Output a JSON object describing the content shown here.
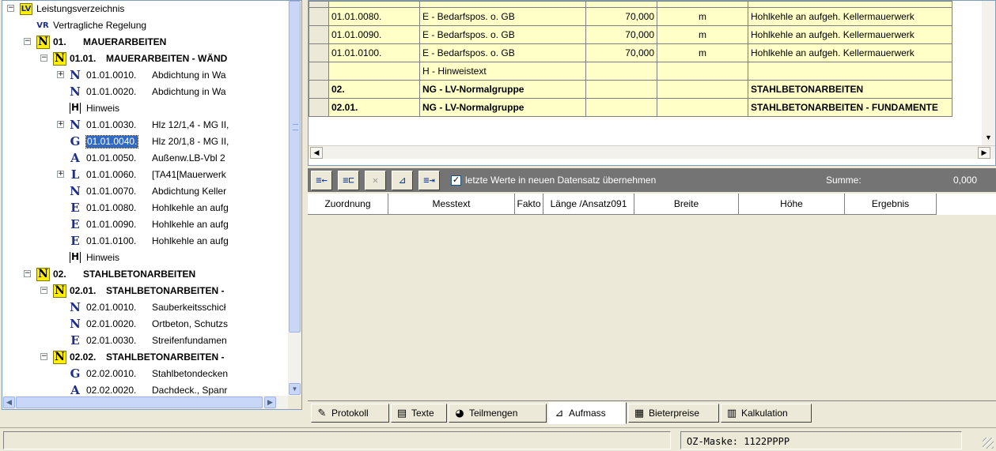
{
  "tree": {
    "nodes": [
      {
        "indent": 0,
        "expander": "−",
        "icon": "LV",
        "icon_label": "LV",
        "text": "Leistungsverzeichnis",
        "tail": "",
        "bold": false,
        "selected": false
      },
      {
        "indent": 1,
        "expander": "",
        "icon": "VR",
        "icon_label": "VR",
        "text": "Vertragliche Regelung",
        "tail": "",
        "bold": false,
        "selected": false
      },
      {
        "indent": 1,
        "expander": "−",
        "icon": "Nbox",
        "icon_label": "N",
        "text": "01.",
        "tail": "MAUERARBEITEN",
        "bold": true,
        "selected": false
      },
      {
        "indent": 2,
        "expander": "−",
        "icon": "Nbox",
        "icon_label": "N",
        "text": "01.01.",
        "tail": "MAUERARBEITEN - WÄND",
        "bold": true,
        "selected": false
      },
      {
        "indent": 3,
        "expander": "+",
        "icon": "N",
        "icon_label": "N",
        "text": "01.01.0010.",
        "tail": "Abdichtung in Wa",
        "bold": false,
        "selected": false
      },
      {
        "indent": 3,
        "expander": "",
        "icon": "N",
        "icon_label": "N",
        "text": "01.01.0020.",
        "tail": "Abdichtung in Wa",
        "bold": false,
        "selected": false
      },
      {
        "indent": 3,
        "expander": "",
        "icon": "H",
        "icon_label": "H",
        "text": "Hinweis",
        "tail": "",
        "bold": false,
        "selected": false
      },
      {
        "indent": 3,
        "expander": "+",
        "icon": "N",
        "icon_label": "N",
        "text": "01.01.0030.",
        "tail": "Hlz 12/1,4 - MG II,",
        "bold": false,
        "selected": false
      },
      {
        "indent": 3,
        "expander": "",
        "icon": "G",
        "icon_label": "G",
        "text": "01.01.0040.",
        "tail": "Hlz 20/1,8 - MG II,",
        "bold": false,
        "selected": true
      },
      {
        "indent": 3,
        "expander": "",
        "icon": "A",
        "icon_label": "A",
        "text": "01.01.0050.",
        "tail": "Außenw.LB-Vbl 2",
        "bold": false,
        "selected": false
      },
      {
        "indent": 3,
        "expander": "+",
        "icon": "L",
        "icon_label": "L",
        "text": "01.01.0060.",
        "tail": "[TA41[Mauerwerk",
        "bold": false,
        "selected": false
      },
      {
        "indent": 3,
        "expander": "",
        "icon": "N",
        "icon_label": "N",
        "text": "01.01.0070.",
        "tail": "Abdichtung Keller",
        "bold": false,
        "selected": false
      },
      {
        "indent": 3,
        "expander": "",
        "icon": "E",
        "icon_label": "E",
        "text": "01.01.0080.",
        "tail": "Hohlkehle an aufg",
        "bold": false,
        "selected": false
      },
      {
        "indent": 3,
        "expander": "",
        "icon": "E",
        "icon_label": "E",
        "text": "01.01.0090.",
        "tail": "Hohlkehle an aufg",
        "bold": false,
        "selected": false
      },
      {
        "indent": 3,
        "expander": "",
        "icon": "E",
        "icon_label": "E",
        "text": "01.01.0100.",
        "tail": "Hohlkehle an aufg",
        "bold": false,
        "selected": false
      },
      {
        "indent": 3,
        "expander": "",
        "icon": "H",
        "icon_label": "H",
        "text": "Hinweis",
        "tail": "",
        "bold": false,
        "selected": false
      },
      {
        "indent": 1,
        "expander": "−",
        "icon": "Nbox",
        "icon_label": "N",
        "text": "02.",
        "tail": "STAHLBETONARBEITEN",
        "bold": true,
        "selected": false
      },
      {
        "indent": 2,
        "expander": "−",
        "icon": "Nbox",
        "icon_label": "N",
        "text": "02.01.",
        "tail": "STAHLBETONARBEITEN -",
        "bold": true,
        "selected": false
      },
      {
        "indent": 3,
        "expander": "",
        "icon": "N",
        "icon_label": "N",
        "text": "02.01.0010.",
        "tail": "Sauberkeitsschicł",
        "bold": false,
        "selected": false
      },
      {
        "indent": 3,
        "expander": "",
        "icon": "N",
        "icon_label": "N",
        "text": "02.01.0020.",
        "tail": "Ortbeton, Schutzs",
        "bold": false,
        "selected": false
      },
      {
        "indent": 3,
        "expander": "",
        "icon": "E",
        "icon_label": "E",
        "text": "02.01.0030.",
        "tail": "Streifenfundamen",
        "bold": false,
        "selected": false
      },
      {
        "indent": 2,
        "expander": "−",
        "icon": "Nbox",
        "icon_label": "N",
        "text": "02.02.",
        "tail": "STAHLBETONARBEITEN -",
        "bold": true,
        "selected": false
      },
      {
        "indent": 3,
        "expander": "",
        "icon": "G",
        "icon_label": "G",
        "text": "02.02.0010.",
        "tail": "Stahlbetondecken",
        "bold": false,
        "selected": false
      },
      {
        "indent": 3,
        "expander": "",
        "icon": "A",
        "icon_label": "A",
        "text": "02.02.0020.",
        "tail": "Dachdeck., Spanr",
        "bold": false,
        "selected": false
      }
    ]
  },
  "grid": {
    "rows": [
      {
        "oz": "01.01.0080.",
        "art": "E - Bedarfspos. o. GB",
        "menge": "70,000",
        "einheit": "m",
        "kurztext": "Hohlkehle an aufgeh. Kellermauerwerk",
        "bold": false
      },
      {
        "oz": "01.01.0090.",
        "art": "E - Bedarfspos. o. GB",
        "menge": "70,000",
        "einheit": "m",
        "kurztext": "Hohlkehle an aufgeh. Kellermauerwerk",
        "bold": false
      },
      {
        "oz": "01.01.0100.",
        "art": "E - Bedarfspos. o. GB",
        "menge": "70,000",
        "einheit": "m",
        "kurztext": "Hohlkehle an aufgeh. Kellermauerwerk",
        "bold": false
      },
      {
        "oz": "",
        "art": "H - Hinweistext",
        "menge": "",
        "einheit": "",
        "kurztext": "",
        "bold": false
      },
      {
        "oz": "02.",
        "art": "NG - LV-Normalgruppe",
        "menge": "",
        "einheit": "",
        "kurztext": "STAHLBETONARBEITEN",
        "bold": true
      },
      {
        "oz": "02.01.",
        "art": "NG - LV-Normalgruppe",
        "menge": "",
        "einheit": "",
        "kurztext": "STAHLBETONARBEITEN - FUNDAMENTE",
        "bold": true
      }
    ]
  },
  "toolbar": {
    "buttons": [
      {
        "name": "insert-row-button",
        "glyph": "≡←",
        "disabled": false
      },
      {
        "name": "insert-subrow-button",
        "glyph": "≡⊏",
        "disabled": false
      },
      {
        "name": "delete-button",
        "glyph": "✕",
        "disabled": true
      },
      {
        "name": "measure-button",
        "glyph": "⊿",
        "disabled": false
      },
      {
        "name": "transfer-button",
        "glyph": "≡⇥",
        "disabled": false
      }
    ],
    "check_mark": "✓",
    "check_label": "letzte Werte in neuen Datensatz übernehmen",
    "sum_label": "Summe:",
    "sum_value": "0,000"
  },
  "measurement": {
    "columns": [
      "Zuordnung",
      "Messtext",
      "Fakto",
      "Länge /Ansatz091",
      "Breite",
      "Höhe",
      "Ergebnis"
    ]
  },
  "tabs": [
    {
      "label": "Protokoll",
      "icon": "protocol-icon",
      "glyph": "✎",
      "active": false
    },
    {
      "label": "Texte",
      "icon": "text-icon",
      "glyph": "▤",
      "active": false
    },
    {
      "label": "Teilmengen",
      "icon": "subsets-icon",
      "glyph": "◕",
      "active": false
    },
    {
      "label": "Aufmass",
      "icon": "measure-icon",
      "glyph": "⊿",
      "active": true
    },
    {
      "label": "Bieterpreise",
      "icon": "bidder-prices-icon",
      "glyph": "▦",
      "active": false
    },
    {
      "label": "Kalkulation",
      "icon": "calculator-icon",
      "glyph": "▥",
      "active": false
    }
  ],
  "statusbar": {
    "mask_text": "OZ-Maske: 1122PPPP"
  },
  "colors": {
    "selection": "#316ac5",
    "grid_row": "#ffffc8",
    "toolbar_bg": "#747474",
    "group_icon": "#ffee00"
  }
}
